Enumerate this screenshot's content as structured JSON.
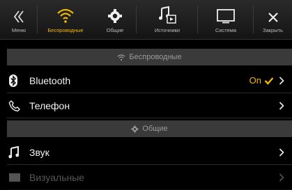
{
  "tabs": [
    {
      "label": "Меню",
      "icon": "back-double-chevron-icon"
    },
    {
      "label": "Беспроводные",
      "icon": "wifi-icon",
      "active": true
    },
    {
      "label": "Общие",
      "icon": "gear-icon"
    },
    {
      "label": "Источники",
      "icon": "music-source-icon"
    },
    {
      "label": "Система",
      "icon": "monitor-icon"
    },
    {
      "label": "Закрыть",
      "icon": "close-icon"
    }
  ],
  "sections": {
    "wireless": {
      "title": "Беспроводные"
    },
    "general": {
      "title": "Общие"
    }
  },
  "rows": {
    "bluetooth": {
      "label": "Bluetooth",
      "value": "On"
    },
    "phone": {
      "label": "Телефон"
    },
    "sound": {
      "label": "Звук"
    },
    "visual": {
      "label": "Визуальные"
    }
  },
  "colors": {
    "accent": "#f2b705",
    "background": "#000000",
    "section": "#3a3a3a"
  }
}
